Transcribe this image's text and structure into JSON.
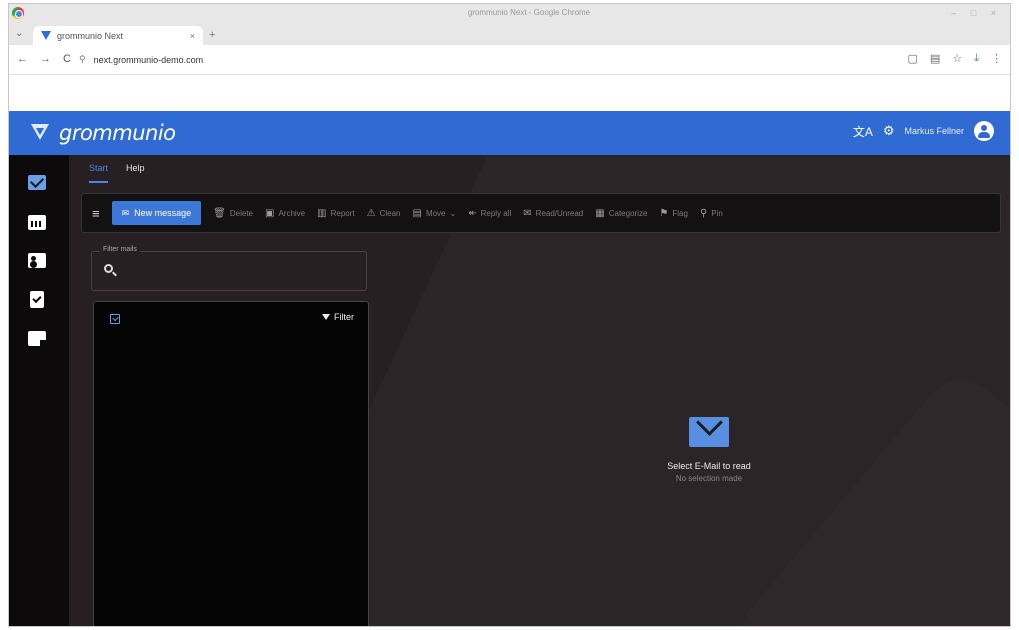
{
  "browser": {
    "window_title": "grommunio Next - Google Chrome",
    "tab_title": "grommunio Next",
    "tab_close": "×",
    "new_tab": "+",
    "back": "←",
    "forward": "→",
    "reload": "C",
    "url": "next.grommunio-demo.com"
  },
  "app": {
    "brand": "grommunio",
    "user_name": "Markus Fellner",
    "menu_tabs": [
      {
        "label": "Start",
        "active": true
      },
      {
        "label": "Help",
        "active": false
      }
    ],
    "toolbar": {
      "new_message": "New message",
      "actions": [
        "Delete",
        "Archive",
        "Report",
        "Clean",
        "Move",
        "Reply all",
        "Read/Unread",
        "Categorize",
        "Flag",
        "Pin"
      ]
    },
    "filter": {
      "label": "Filter mails",
      "placeholder": ""
    },
    "list": {
      "filter_button": "Filter"
    },
    "empty_state": {
      "title": "Select E-Mail to read",
      "subtitle": "No selection made"
    }
  },
  "colors": {
    "header_blue": "#2f6bd3",
    "accent": "#3d78d8",
    "rail": "#0c0a0b",
    "background": "#262022"
  }
}
